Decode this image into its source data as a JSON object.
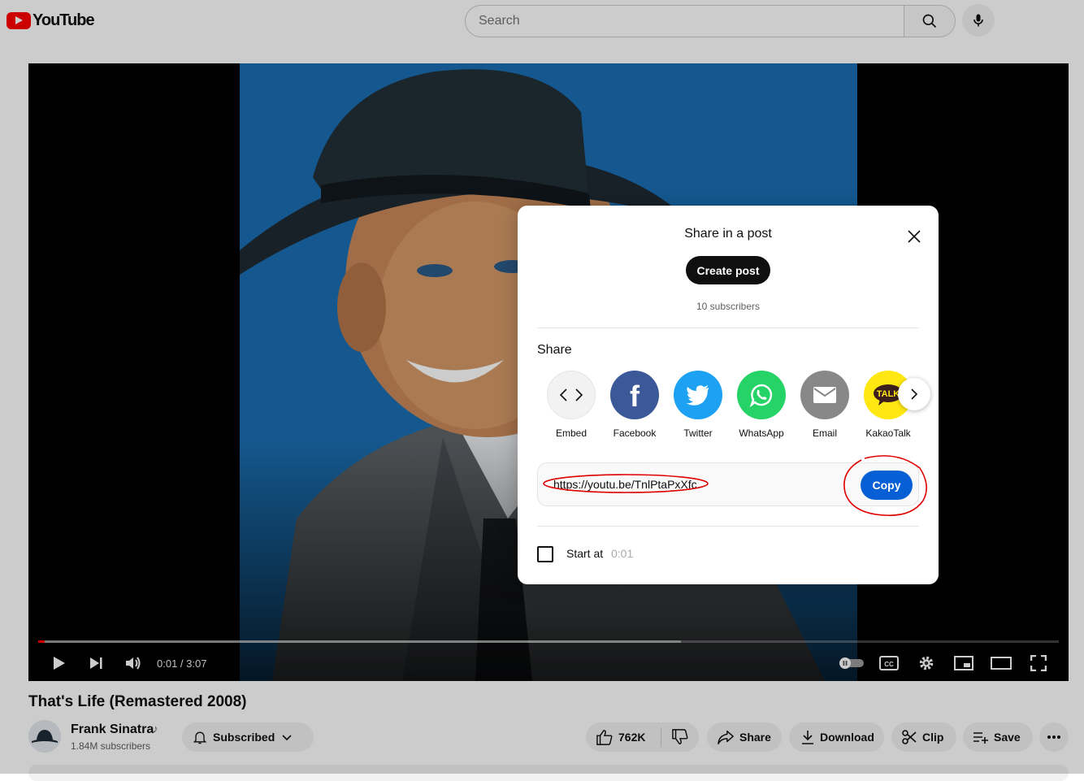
{
  "app": {
    "brand": "YouTube"
  },
  "search": {
    "placeholder": "Search"
  },
  "player": {
    "current_time": "0:01",
    "duration": "3:07",
    "time_display": "0:01 / 3:07",
    "progress_fraction": 0.005,
    "buffered_fraction": 0.63
  },
  "video": {
    "title": "That's Life (Remastered 2008)",
    "channel": "Frank Sinatra",
    "channel_badge": "♪",
    "subscribers": "1.84M subscribers"
  },
  "actions": {
    "subscribe_label": "Subscribed",
    "like_count": "762K",
    "share_label": "Share",
    "download_label": "Download",
    "clip_label": "Clip",
    "save_label": "Save"
  },
  "dialog": {
    "post_heading": "Share in a post",
    "create_post_label": "Create post",
    "subscriber_count": "10 subscribers",
    "share_heading": "Share",
    "targets": [
      {
        "label": "Embed",
        "icon": "embed-icon",
        "color": "#f2f2f2"
      },
      {
        "label": "Facebook",
        "icon": "facebook-icon",
        "color": "#3b5998"
      },
      {
        "label": "Twitter",
        "icon": "twitter-icon",
        "color": "#1da1f2"
      },
      {
        "label": "WhatsApp",
        "icon": "whatsapp-icon",
        "color": "#25d366"
      },
      {
        "label": "Email",
        "icon": "email-icon",
        "color": "#888888"
      },
      {
        "label": "KakaoTalk",
        "icon": "kakaotalk-icon",
        "color": "#ffe812",
        "badge": "TALK"
      }
    ],
    "url": "https://youtu.be/TnlPtaPxXfc",
    "copy_label": "Copy",
    "start_at_label": "Start at",
    "start_at_time": "0:01"
  },
  "colors": {
    "accent": "#065fd4",
    "brand_red": "#ff0000",
    "annotation_red": "#e00000"
  }
}
